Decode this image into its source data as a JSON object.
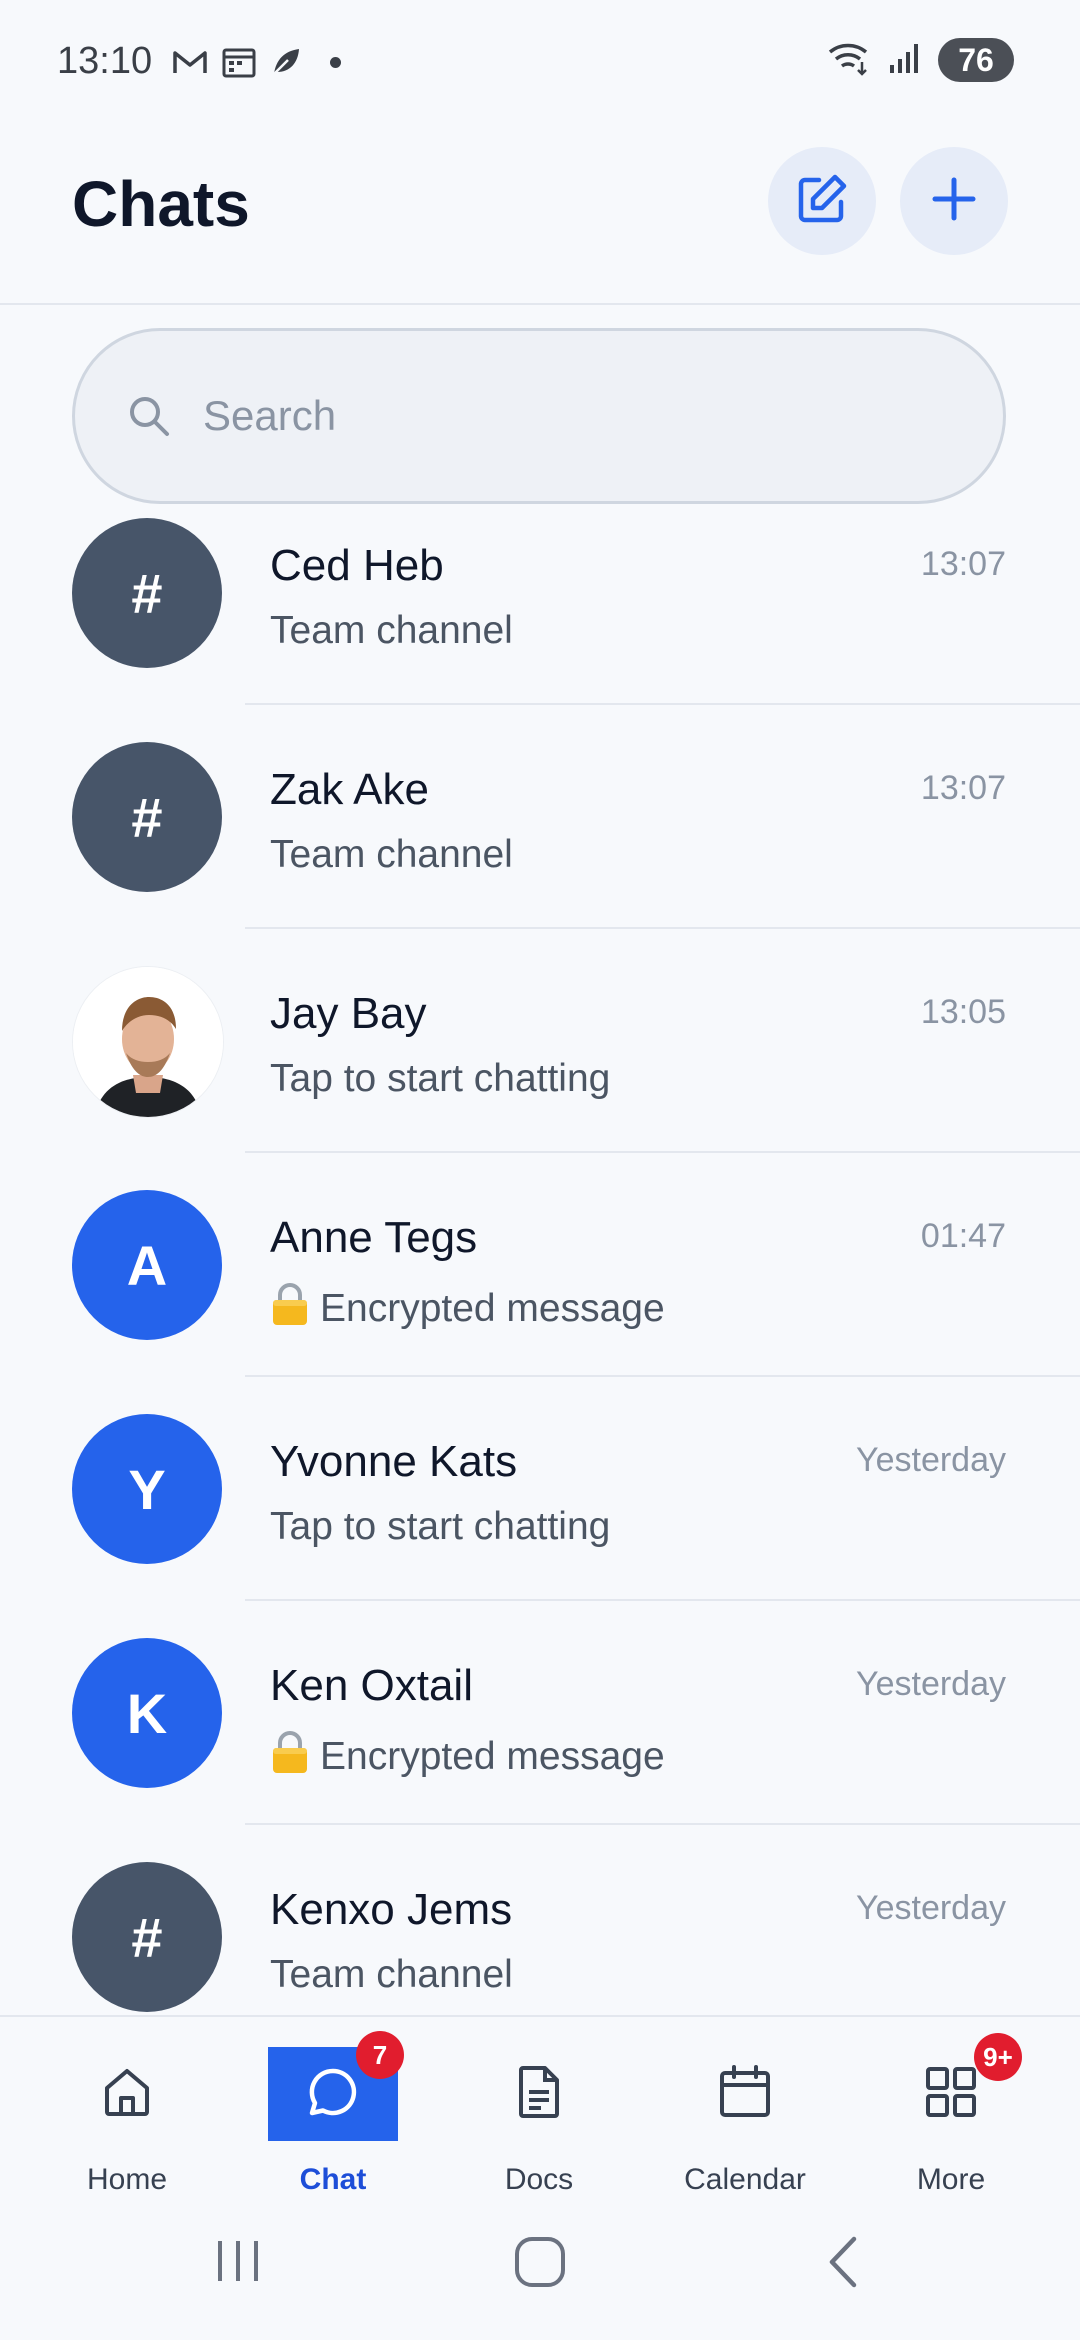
{
  "status_bar": {
    "time": "13:10",
    "battery": "76",
    "left_icons": [
      "gmail-icon",
      "calendar-icon",
      "leaf-icon",
      "dot"
    ],
    "right_icons": [
      "wifi-icon",
      "signal-icon"
    ]
  },
  "header": {
    "title": "Chats",
    "compose_icon": "edit-icon",
    "add_icon": "plus-icon"
  },
  "search": {
    "placeholder": "Search"
  },
  "chats": [
    {
      "name": "Ced Heb",
      "subtitle": "Team channel",
      "time": "13:07",
      "avatar_type": "channel",
      "avatar_text": "#",
      "avatar_color": "#475569"
    },
    {
      "name": "Zak Ake",
      "subtitle": "Team channel",
      "time": "13:07",
      "avatar_type": "channel",
      "avatar_text": "#",
      "avatar_color": "#475569"
    },
    {
      "name": "Jay Bay",
      "subtitle": "Tap to start chatting",
      "time": "13:05",
      "avatar_type": "photo",
      "avatar_text": "",
      "avatar_color": "#ffffff"
    },
    {
      "name": "Anne Tegs",
      "subtitle": "Encrypted message",
      "time": "01:47",
      "avatar_type": "initial",
      "avatar_text": "A",
      "avatar_color": "#2563eb",
      "lock": true
    },
    {
      "name": "Yvonne Kats",
      "subtitle": "Tap to start chatting",
      "time": "Yesterday",
      "avatar_type": "initial",
      "avatar_text": "Y",
      "avatar_color": "#2563eb"
    },
    {
      "name": "Ken Oxtail",
      "subtitle": "Encrypted message",
      "time": "Yesterday",
      "avatar_type": "initial",
      "avatar_text": "K",
      "avatar_color": "#2563eb",
      "lock": true
    },
    {
      "name": "Kenxo Jems",
      "subtitle": "Team channel",
      "time": "Yesterday",
      "avatar_type": "channel",
      "avatar_text": "#",
      "avatar_color": "#475569"
    }
  ],
  "bottom_nav": [
    {
      "label": "Home",
      "icon": "home-icon"
    },
    {
      "label": "Chat",
      "icon": "chat-bubble-icon",
      "badge": "7",
      "active": true
    },
    {
      "label": "Docs",
      "icon": "document-icon"
    },
    {
      "label": "Calendar",
      "icon": "calendar-icon"
    },
    {
      "label": "More",
      "icon": "grid-icon",
      "badge": "9+"
    }
  ],
  "colors": {
    "accent": "#2563eb",
    "badge": "#e11d2e",
    "channel_avatar": "#475569"
  }
}
